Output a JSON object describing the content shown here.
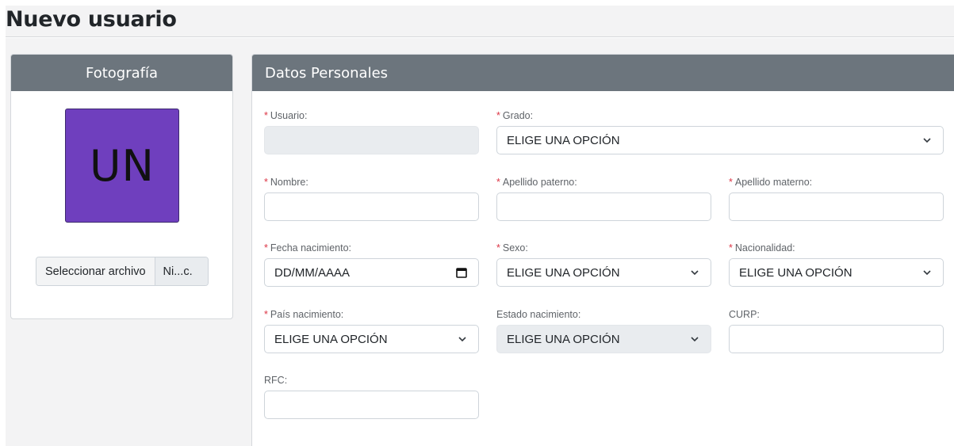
{
  "page": {
    "title": "Nuevo usuario"
  },
  "photo_card": {
    "title": "Fotografía",
    "avatar_initials": "UN",
    "avatar_color": "#6f3fbe",
    "file_button_label": "Seleccionar archivo",
    "file_name": "Ni...c."
  },
  "data_card": {
    "title": "Datos Personales",
    "required_mark": "*",
    "fields": {
      "usuario": {
        "label": "Usuario:",
        "value": ""
      },
      "grado": {
        "label": "Grado:",
        "value": "ELIGE UNA OPCIÓN"
      },
      "nombre": {
        "label": "Nombre:",
        "value": ""
      },
      "apellido_paterno": {
        "label": "Apellido paterno:",
        "value": ""
      },
      "apellido_materno": {
        "label": "Apellido materno:",
        "value": ""
      },
      "fecha_nacimiento": {
        "label": "Fecha nacimiento:",
        "value": "DD/MM/AAAA"
      },
      "sexo": {
        "label": "Sexo:",
        "value": "ELIGE UNA OPCIÓN"
      },
      "nacionalidad": {
        "label": "Nacionalidad:",
        "value": "ELIGE UNA OPCIÓN"
      },
      "pais_nacimiento": {
        "label": "País nacimiento:",
        "value": "ELIGE UNA OPCIÓN"
      },
      "estado_nacimiento": {
        "label": "Estado nacimiento:",
        "value": "ELIGE UNA OPCIÓN"
      },
      "curp": {
        "label": "CURP:",
        "value": ""
      },
      "rfc": {
        "label": "RFC:",
        "value": ""
      }
    }
  },
  "icons": {
    "select": "chevron-down-icon",
    "date": "calendar-icon"
  },
  "colors": {
    "header_bg": "#6c757d",
    "required": "#dc3545",
    "disabled_bg": "#e9ecef"
  }
}
